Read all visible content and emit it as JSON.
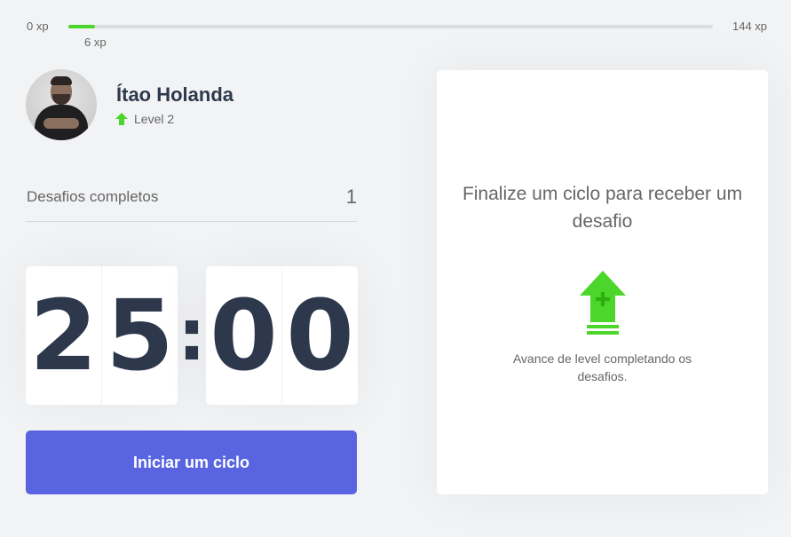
{
  "experience": {
    "min_label": "0 xp",
    "max_label": "144 xp",
    "current_label": "6 xp",
    "current": 6,
    "max": 144,
    "fill_color": "#4cd62b"
  },
  "profile": {
    "name": "Ítao Holanda",
    "level_label": "Level 2",
    "level_icon": "level-up-arrow-icon"
  },
  "challenges": {
    "label": "Desafios completos",
    "count": "1"
  },
  "countdown": {
    "minute_left": "2",
    "minute_right": "5",
    "separator": ":",
    "second_left": "0",
    "second_right": "0"
  },
  "start_button": {
    "label": "Iniciar um ciclo",
    "color": "#5965e0"
  },
  "challenge_box": {
    "title": "Finalize um ciclo para receber um desafio",
    "icon": "level-up-icon",
    "text": "Avance de level completando os desafios."
  },
  "colors": {
    "background": "#f2f3f5",
    "text": "#666666",
    "title": "#2e384d",
    "green": "#4cd62b"
  }
}
